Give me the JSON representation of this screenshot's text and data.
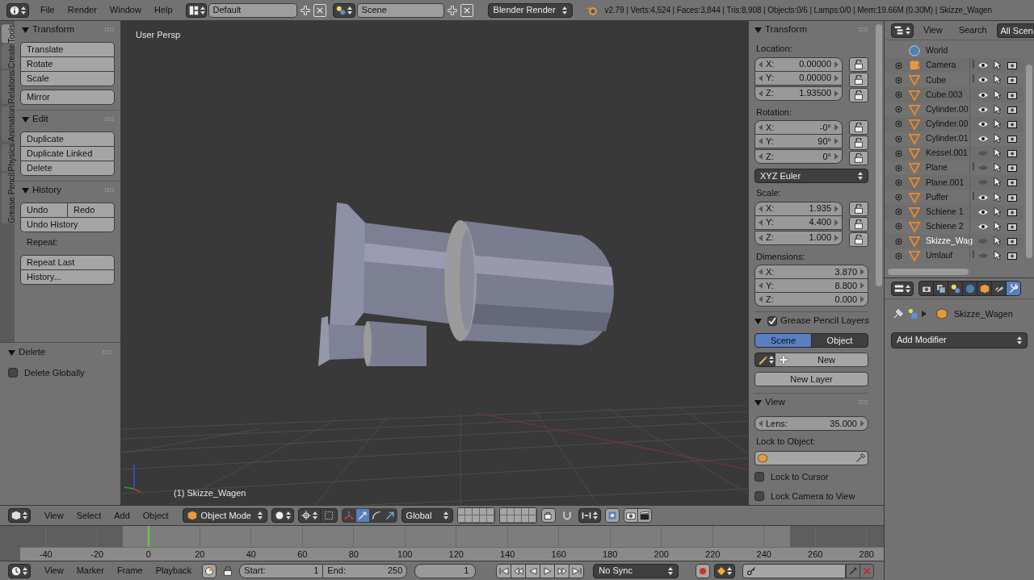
{
  "top_bar": {
    "menus": [
      "File",
      "Render",
      "Window",
      "Help"
    ],
    "layout": "Default",
    "scene": "Scene",
    "engine": "Blender Render",
    "stats": "v2.79 | Verts:4,524 | Faces:3,844 | Tris:8,908 | Objects:0/6 | Lamps:0/0 | Mem:19.66M (0.30M) | Skizze_Wagen"
  },
  "tool_shelf": {
    "tabs": [
      {
        "label": "Tools",
        "selected": true
      },
      {
        "label": "Create",
        "selected": false
      },
      {
        "label": "Relations",
        "selected": false
      },
      {
        "label": "Animation",
        "selected": false
      },
      {
        "label": "Physics",
        "selected": false
      },
      {
        "label": "Grease Pencil",
        "selected": false
      }
    ],
    "panels": [
      {
        "title": "Transform",
        "expanded": true,
        "blocks": [
          {
            "kind": "buttons",
            "rows": [
              [
                "Translate"
              ],
              [
                "Rotate"
              ],
              [
                "Scale"
              ]
            ]
          },
          {
            "kind": "buttons",
            "rows": [
              [
                "Mirror"
              ]
            ]
          }
        ]
      },
      {
        "title": "Edit",
        "expanded": true,
        "blocks": [
          {
            "kind": "buttons",
            "rows": [
              [
                "Duplicate"
              ],
              [
                "Duplicate Linked"
              ],
              [
                "Delete"
              ]
            ]
          }
        ]
      },
      {
        "title": "History",
        "expanded": true,
        "blocks": [
          {
            "kind": "buttons",
            "rows": [
              [
                "Undo",
                "Redo"
              ],
              [
                "Undo History"
              ]
            ]
          },
          {
            "kind": "label",
            "text": "Repeat:"
          },
          {
            "kind": "buttons",
            "rows": [
              [
                "Repeat Last"
              ],
              [
                "History..."
              ]
            ]
          }
        ]
      }
    ]
  },
  "operator_panel": {
    "title": "Delete",
    "expanded": true,
    "options": [
      {
        "label": "Delete Globally",
        "checked": false
      }
    ]
  },
  "viewport": {
    "view_name": "User Persp",
    "object_name": "(1) Skizze_Wagen"
  },
  "n_panel": {
    "transform": {
      "title": "Transform",
      "expanded": true,
      "groups": [
        {
          "kind": "vector",
          "label": "Location:",
          "lockable": true,
          "fields": [
            {
              "axis": "X:",
              "value": "0.00000",
              "locked": false
            },
            {
              "axis": "Y:",
              "value": "0.00000",
              "locked": false
            },
            {
              "axis": "Z:",
              "value": "1.93500",
              "locked": false
            }
          ]
        },
        {
          "kind": "vector",
          "label": "Rotation:",
          "lockable": true,
          "fields": [
            {
              "axis": "X:",
              "value": "-0°",
              "locked": false
            },
            {
              "axis": "Y:",
              "value": "90°",
              "locked": false
            },
            {
              "axis": "Z:",
              "value": "0°",
              "locked": false
            }
          ]
        },
        {
          "kind": "dropdown",
          "value": "XYZ Euler"
        },
        {
          "kind": "vector",
          "label": "Scale:",
          "lockable": true,
          "fields": [
            {
              "axis": "X:",
              "value": "1.935",
              "locked": false
            },
            {
              "axis": "Y:",
              "value": "4.400",
              "locked": false
            },
            {
              "axis": "Z:",
              "value": "1.000",
              "locked": false
            }
          ]
        },
        {
          "kind": "vector",
          "label": "Dimensions:",
          "lockable": false,
          "fields": [
            {
              "axis": "X:",
              "value": "3.870"
            },
            {
              "axis": "Y:",
              "value": "8.800"
            },
            {
              "axis": "Z:",
              "value": "0.000"
            }
          ]
        }
      ]
    },
    "grease_pencil": {
      "title": "Grease Pencil Layers",
      "expanded": true,
      "enabled": true,
      "sources": [
        {
          "label": "Scene",
          "selected": true
        },
        {
          "label": "Object",
          "selected": false
        }
      ],
      "new_label": "New",
      "new_layer_label": "New Layer"
    },
    "view": {
      "title": "View",
      "expanded": true,
      "lens_label": "Lens:",
      "lens": "35.000",
      "lock_object_label": "Lock to Object:",
      "checks": [
        {
          "label": "Lock to Cursor",
          "checked": false
        },
        {
          "label": "Lock Camera to View",
          "checked": false
        }
      ]
    }
  },
  "outliner": {
    "menus": [
      "View",
      "Search"
    ],
    "scope": "All Scen",
    "items": [
      {
        "name": "World",
        "kind": "world",
        "selected": false
      },
      {
        "name": "Camera",
        "kind": "camera",
        "visible": true,
        "child_icons": true,
        "selected": false
      },
      {
        "name": "Cube",
        "kind": "mesh",
        "visible": true,
        "child_icons": true,
        "selected": false
      },
      {
        "name": "Cube.003",
        "kind": "mesh",
        "visible": true,
        "child_icons": false,
        "selected": false
      },
      {
        "name": "Cylinder.00",
        "kind": "mesh",
        "visible": true,
        "child_icons": false,
        "selected": false
      },
      {
        "name": "Cylinder.00",
        "kind": "mesh",
        "visible": true,
        "child_icons": false,
        "selected": false
      },
      {
        "name": "Cylinder.01",
        "kind": "mesh",
        "visible": true,
        "child_icons": false,
        "selected": false
      },
      {
        "name": "Kessel.001",
        "kind": "mesh",
        "visible": false,
        "child_icons": false,
        "selected": false
      },
      {
        "name": "Plane",
        "kind": "mesh",
        "visible": false,
        "child_icons": true,
        "selected": false
      },
      {
        "name": "Plane.001",
        "kind": "mesh",
        "visible": false,
        "child_icons": false,
        "selected": false
      },
      {
        "name": "Puffer",
        "kind": "mesh",
        "visible": true,
        "child_icons": true,
        "selected": false
      },
      {
        "name": "Schiene 1",
        "kind": "mesh",
        "visible": true,
        "child_icons": false,
        "selected": false
      },
      {
        "name": "Schiene 2",
        "kind": "mesh",
        "visible": true,
        "child_icons": false,
        "selected": false
      },
      {
        "name": "Skizze_Wag",
        "kind": "mesh",
        "visible": false,
        "child_icons": false,
        "selected": true
      },
      {
        "name": "Umlauf",
        "kind": "mesh",
        "visible": false,
        "child_icons": true,
        "selected": false
      }
    ]
  },
  "properties": {
    "tabs": [
      {
        "kind": "render",
        "selected": false
      },
      {
        "kind": "layers",
        "selected": false
      },
      {
        "kind": "scene",
        "selected": false
      },
      {
        "kind": "world",
        "selected": false
      },
      {
        "kind": "object",
        "selected": false
      },
      {
        "kind": "constraints",
        "selected": false
      },
      {
        "kind": "modifiers",
        "selected": true
      }
    ],
    "object_name": "Skizze_Wagen",
    "add_modifier": "Add Modifier"
  },
  "view3d_header": {
    "menus": [
      "View",
      "Select",
      "Add",
      "Object"
    ],
    "mode": "Object Mode",
    "orientation": "Global"
  },
  "timeline": {
    "ticks": [
      {
        "label": "-40",
        "in_range": false,
        "playhead": false
      },
      {
        "label": "-20",
        "in_range": false,
        "playhead": false
      },
      {
        "label": "0",
        "in_range": true,
        "playhead": true
      },
      {
        "label": "20",
        "in_range": true,
        "playhead": false
      },
      {
        "label": "40",
        "in_range": true,
        "playhead": false
      },
      {
        "label": "60",
        "in_range": true,
        "playhead": false
      },
      {
        "label": "80",
        "in_range": true,
        "playhead": false
      },
      {
        "label": "100",
        "in_range": true,
        "playhead": false
      },
      {
        "label": "120",
        "in_range": true,
        "playhead": false
      },
      {
        "label": "140",
        "in_range": true,
        "playhead": false
      },
      {
        "label": "160",
        "in_range": true,
        "playhead": false
      },
      {
        "label": "180",
        "in_range": true,
        "playhead": false
      },
      {
        "label": "200",
        "in_range": true,
        "playhead": false
      },
      {
        "label": "220",
        "in_range": true,
        "playhead": false
      },
      {
        "label": "240",
        "in_range": true,
        "playhead": false
      },
      {
        "label": "260",
        "in_range": false,
        "playhead": false
      },
      {
        "label": "280",
        "in_range": false,
        "playhead": false
      }
    ],
    "header": {
      "menus": [
        "View",
        "Marker",
        "Frame",
        "Playback"
      ],
      "start_label": "Start:",
      "start": "1",
      "end_label": "End:",
      "end": "250",
      "current": "1",
      "sync": "No Sync"
    }
  }
}
